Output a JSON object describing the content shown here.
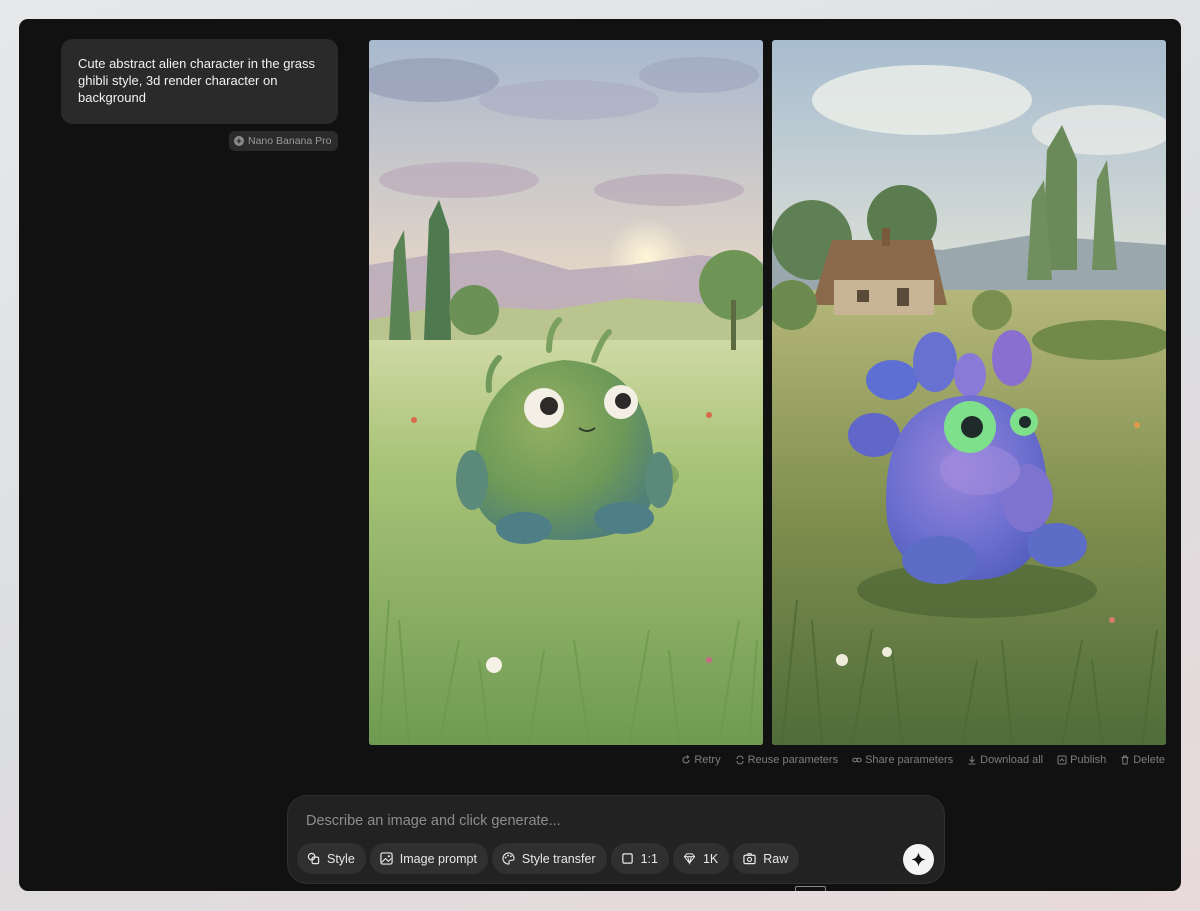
{
  "prompt": {
    "text": "Cute abstract alien character in the grass ghibli style, 3d render character on background",
    "model_badge": "Nano Banana Pro"
  },
  "images": [
    {
      "icon": "green-alien-meadow-image"
    },
    {
      "icon": "purple-alien-cottage-image"
    }
  ],
  "actions": [
    {
      "label": "Retry",
      "icon": "retry-icon"
    },
    {
      "label": "Reuse parameters",
      "icon": "reuse-icon"
    },
    {
      "label": "Share parameters",
      "icon": "link-icon"
    },
    {
      "label": "Download all",
      "icon": "download-icon"
    },
    {
      "label": "Publish",
      "icon": "publish-icon"
    },
    {
      "label": "Delete",
      "icon": "trash-icon"
    }
  ],
  "composer": {
    "placeholder": "Describe an image and click generate...",
    "chips": [
      {
        "label": "Style",
        "icon": "style-icon"
      },
      {
        "label": "Image prompt",
        "icon": "image-icon"
      },
      {
        "label": "Style transfer",
        "icon": "palette-icon"
      },
      {
        "label": "1:1",
        "icon": "square-icon"
      },
      {
        "label": "1K",
        "icon": "diamond-icon"
      },
      {
        "label": "Raw",
        "icon": "camera-icon"
      }
    ],
    "generate_icon": "sparkle-icon"
  },
  "colors": {
    "window_bg": "#111111",
    "panel_bg": "#222222",
    "chip_bg": "#303030",
    "muted_text": "#7d7d7d"
  }
}
